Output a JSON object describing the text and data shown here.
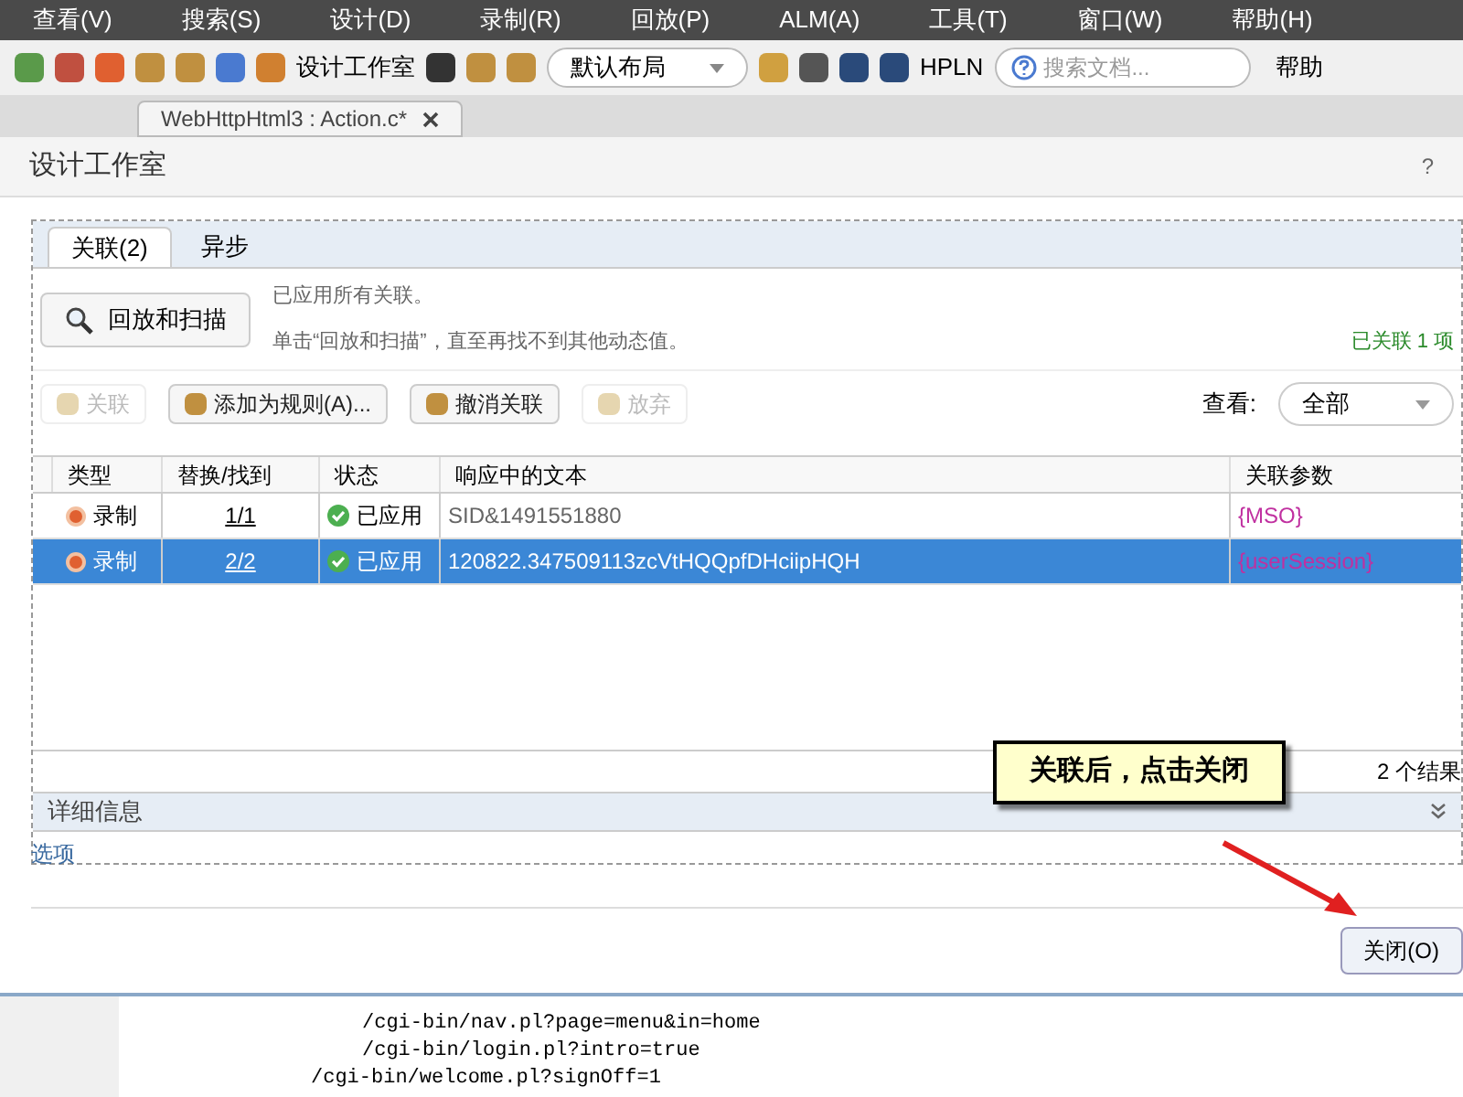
{
  "menu": [
    "查看(V)",
    "搜索(S)",
    "设计(D)",
    "录制(R)",
    "回放(P)",
    "ALM(A)",
    "工具(T)",
    "窗口(W)",
    "帮助(H)"
  ],
  "toolbar": {
    "studio": "设计工作室",
    "layout": "默认布局",
    "hpln": "HPLN",
    "search_placeholder": "搜索文档...",
    "help": "帮助"
  },
  "doc_tab": {
    "label": "WebHttpHtml3 : Action.c*"
  },
  "dialog": {
    "title": "设计工作室",
    "help": "?",
    "tabs": [
      {
        "label": "关联(2)",
        "selected": true
      },
      {
        "label": "异步",
        "selected": false
      }
    ],
    "scan_button": "回放和扫描",
    "info_line_1": "已应用所有关联。",
    "info_line_2": "单击“回放和扫描”，直至再找不到其他动态值。",
    "status_summary": "已关联 1 项",
    "actions": [
      {
        "label": "关联",
        "disabled": true
      },
      {
        "label": "添加为规则(A)...",
        "disabled": false
      },
      {
        "label": "撤消关联",
        "disabled": false
      },
      {
        "label": "放弃",
        "disabled": true
      }
    ],
    "view_label": "查看:",
    "view_value": "全部",
    "columns": [
      "类型",
      "替换/找到",
      "状态",
      "响应中的文本",
      "关联参数"
    ],
    "rows": [
      {
        "type": "录制",
        "replaced": "1/1",
        "status": "已应用",
        "text": "SID&1491551880",
        "param": "{MSO}",
        "selected": false
      },
      {
        "type": "录制",
        "replaced": "2/2",
        "status": "已应用",
        "text": "120822.347509113zcVtHQQpfDHciipHQH",
        "param": "{userSession}",
        "selected": true
      }
    ],
    "result_count": "2 个结果",
    "details": "详细信息",
    "options_link": "选项",
    "close_button": "关闭(O)"
  },
  "callout": "关联后，点击关闭",
  "code_lines": [
    {
      "text": "/cgi-bin/nav.pl?page=menu&in=home",
      "indent": true
    },
    {
      "text": "/cgi-bin/login.pl?intro=true",
      "indent": true
    },
    {
      "text": "/cgi-bin/welcome.pl?signOff=1",
      "indent": false
    }
  ]
}
